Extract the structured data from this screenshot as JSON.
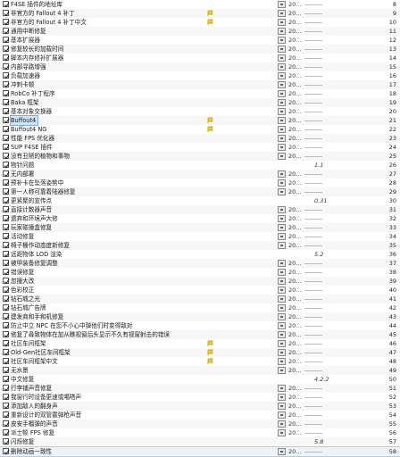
{
  "mod_list": {
    "rows": [
      {
        "name": "F4SE 插件的地址库",
        "cat": "20...",
        "pri": "8",
        "checked": true,
        "type": "mod",
        "flag": false,
        "box": true,
        "ver": ""
      },
      {
        "name": "非官方的 Fallout 4 补丁",
        "cat": "20...",
        "pri": "9",
        "checked": true,
        "type": "mod",
        "flag": true,
        "box": true,
        "ver": ""
      },
      {
        "name": "非官方的 Fallout 4 补丁中文",
        "cat": "20...",
        "pri": "10",
        "checked": true,
        "type": "mod",
        "flag": true,
        "box": true,
        "ver": ""
      },
      {
        "name": "通用中断修复",
        "cat": "20...",
        "pri": "11",
        "checked": true,
        "type": "mod",
        "flag": false,
        "box": true,
        "ver": ""
      },
      {
        "name": "基本扩展器",
        "cat": "20...",
        "pri": "12",
        "checked": true,
        "type": "mod",
        "flag": false,
        "box": true,
        "ver": ""
      },
      {
        "name": "修复较长的加载时间",
        "cat": "20...",
        "pri": "13",
        "checked": true,
        "type": "mod",
        "flag": false,
        "box": true,
        "ver": ""
      },
      {
        "name": "脚本内存修补扩展器",
        "cat": "20...",
        "pri": "14",
        "checked": true,
        "type": "mod",
        "flag": false,
        "box": true,
        "ver": ""
      },
      {
        "name": "内部寻路增强",
        "cat": "20...",
        "pri": "15",
        "checked": true,
        "type": "mod",
        "flag": false,
        "box": true,
        "ver": ""
      },
      {
        "name": "负载加速器",
        "cat": "20...",
        "pri": "16",
        "checked": true,
        "type": "mod",
        "flag": false,
        "box": true,
        "ver": ""
      },
      {
        "name": "冲刺卡顿",
        "cat": "20...",
        "pri": "17",
        "checked": true,
        "type": "mod",
        "flag": false,
        "box": true,
        "ver": ""
      },
      {
        "name": "RobCo 补丁程序",
        "cat": "20...",
        "pri": "18",
        "checked": true,
        "type": "mod",
        "flag": false,
        "box": true,
        "ver": ""
      },
      {
        "name": "Baka 框架",
        "cat": "20...",
        "pri": "19",
        "checked": true,
        "type": "mod",
        "flag": false,
        "box": true,
        "ver": ""
      },
      {
        "name": "基本对象交换器",
        "cat": "20...",
        "pri": "20",
        "checked": true,
        "type": "mod",
        "flag": false,
        "box": true,
        "ver": ""
      },
      {
        "name": "Buffout4",
        "cat": "20...",
        "pri": "21",
        "checked": true,
        "type": "mod",
        "flag": true,
        "box": true,
        "ver": "",
        "selected": true
      },
      {
        "name": "Buffout4 NG",
        "cat": "20...",
        "pri": "22",
        "checked": true,
        "type": "mod",
        "flag": true,
        "box": true,
        "ver": ""
      },
      {
        "name": "性能 FPS 优化器",
        "cat": "20...",
        "pri": "23",
        "checked": true,
        "type": "mod",
        "flag": false,
        "box": true,
        "ver": ""
      },
      {
        "name": "SUP F4SE 插件",
        "cat": "20...",
        "pri": "24",
        "checked": true,
        "type": "mod",
        "flag": false,
        "box": true,
        "ver": ""
      },
      {
        "name": "没有丑陋的植物和事物",
        "cat": "20...",
        "pri": "25",
        "checked": true,
        "type": "mod",
        "flag": false,
        "box": true,
        "ver": ""
      },
      {
        "name": "物针问题",
        "cat": "1.1",
        "pri": "26",
        "checked": true,
        "type": "mod",
        "flag": false,
        "box": false,
        "ver": "",
        "verstyle": true
      },
      {
        "name": "无内部署",
        "cat": "20...",
        "pri": "27",
        "checked": true,
        "type": "mod",
        "flag": false,
        "box": true,
        "ver": ""
      },
      {
        "name": "预补卡在坠落姿势中",
        "cat": "20...",
        "pri": "28",
        "checked": true,
        "type": "mod",
        "flag": false,
        "box": true,
        "ver": ""
      },
      {
        "name": "第一人称可靠着陆器修复",
        "cat": "20...",
        "pri": "29",
        "checked": true,
        "type": "mod",
        "flag": false,
        "box": true,
        "ver": ""
      },
      {
        "name": "更紧聚的宣传点",
        "cat": "0.31",
        "pri": "30",
        "checked": true,
        "type": "mod",
        "flag": false,
        "box": false,
        "ver": "",
        "verstyle": true
      },
      {
        "name": "直接计数器声音",
        "cat": "20...",
        "pri": "31",
        "checked": true,
        "type": "mod",
        "flag": false,
        "box": true,
        "ver": ""
      },
      {
        "name": "遗弃和环境声大修",
        "cat": "20...",
        "pri": "32",
        "checked": true,
        "type": "mod",
        "flag": false,
        "box": true,
        "ver": ""
      },
      {
        "name": "玩家碰撞盒修复",
        "cat": "20...",
        "pri": "33",
        "checked": true,
        "type": "mod",
        "flag": false,
        "box": true,
        "ver": ""
      },
      {
        "name": "活动修复",
        "cat": "20...",
        "pri": "34",
        "checked": true,
        "type": "mod",
        "flag": false,
        "box": true,
        "ver": ""
      },
      {
        "name": "椅子栅作动态度新修复",
        "cat": "20...",
        "pri": "35",
        "checked": true,
        "type": "mod",
        "flag": false,
        "box": true,
        "ver": ""
      },
      {
        "name": "远距物体 LOD 渲染",
        "cat": "5.2",
        "pri": "36",
        "checked": true,
        "type": "mod",
        "flag": false,
        "box": false,
        "ver": "",
        "verstyle": true
      },
      {
        "name": "被甲装备修复调整",
        "cat": "20...",
        "pri": "37",
        "checked": true,
        "type": "mod",
        "flag": false,
        "box": true,
        "ver": ""
      },
      {
        "name": "错误修复",
        "cat": "20...",
        "pri": "38",
        "checked": true,
        "type": "mod",
        "flag": false,
        "box": true,
        "ver": ""
      },
      {
        "name": "忽撞大改",
        "cat": "20...",
        "pri": "39",
        "checked": true,
        "type": "mod",
        "flag": false,
        "box": true,
        "ver": ""
      },
      {
        "name": "色彩校正",
        "cat": "20...",
        "pri": "40",
        "checked": true,
        "type": "mod",
        "flag": false,
        "box": true,
        "ver": ""
      },
      {
        "name": "钻石城之光",
        "cat": "20...",
        "pri": "41",
        "checked": true,
        "type": "mod",
        "flag": false,
        "box": true,
        "ver": ""
      },
      {
        "name": "钻石城广告牌",
        "cat": "20...",
        "pri": "42",
        "checked": true,
        "type": "mod",
        "flag": false,
        "box": true,
        "ver": ""
      },
      {
        "name": "建发商和手和机修复",
        "cat": "20...",
        "pri": "43",
        "checked": true,
        "type": "mod",
        "flag": false,
        "box": true,
        "ver": ""
      },
      {
        "name": "防止中立 NPC 在您不小心中弹他们时变得敌对",
        "cat": "20...",
        "pri": "44",
        "checked": true,
        "type": "mod",
        "flag": false,
        "box": true,
        "ver": ""
      },
      {
        "name": "修复了尋致物体在加从瞧视窗后头显示不久有视窗射击的错误",
        "cat": "20...",
        "pri": "45",
        "checked": true,
        "type": "mod",
        "flag": false,
        "box": true,
        "ver": ""
      },
      {
        "name": "社区车间框架",
        "cat": "20...",
        "pri": "46",
        "checked": true,
        "type": "mod",
        "flag": true,
        "box": true,
        "ver": ""
      },
      {
        "name": "Old-Gen社区车间框架",
        "cat": "20...",
        "pri": "47",
        "checked": true,
        "type": "mod",
        "flag": true,
        "box": true,
        "ver": ""
      },
      {
        "name": "社区车间框架中文",
        "cat": "20...",
        "pri": "48",
        "checked": true,
        "type": "mod",
        "flag": true,
        "box": true,
        "ver": ""
      },
      {
        "name": "无水景",
        "cat": "20...",
        "pri": "49",
        "checked": true,
        "type": "mod",
        "flag": false,
        "box": true,
        "ver": ""
      },
      {
        "name": "中文修复",
        "cat": "4.2.2",
        "pri": "50",
        "checked": true,
        "type": "mod",
        "flag": false,
        "box": false,
        "ver": "",
        "verstyle": true
      },
      {
        "name": "行李铺声音修复",
        "cat": "20...",
        "pri": "51",
        "checked": true,
        "type": "mod",
        "flag": false,
        "box": true,
        "ver": ""
      },
      {
        "name": "我窗行时设备更速或噶嗒声",
        "cat": "20...",
        "pri": "52",
        "checked": true,
        "type": "mod",
        "flag": false,
        "box": true,
        "ver": ""
      },
      {
        "name": "添加敌人的翻身声",
        "cat": "20...",
        "pri": "53",
        "checked": true,
        "type": "mod",
        "flag": false,
        "box": true,
        "ver": ""
      },
      {
        "name": "重新设计的双管霰弹枪声音",
        "cat": "20...",
        "pri": "54",
        "checked": true,
        "type": "mod",
        "flag": false,
        "box": true,
        "ver": ""
      },
      {
        "name": "皮安手榴弹的声音",
        "cat": "20...",
        "pri": "55",
        "checked": true,
        "type": "mod",
        "flag": false,
        "box": true,
        "ver": ""
      },
      {
        "name": "派士顿 FPS 修复",
        "cat": "20...",
        "pri": "56",
        "checked": true,
        "type": "mod",
        "flag": false,
        "box": true,
        "ver": ""
      },
      {
        "name": "闪烁修复",
        "cat": "5.8",
        "pri": "57",
        "checked": true,
        "type": "mod",
        "flag": false,
        "box": false,
        "ver": "",
        "verstyle": true
      },
      {
        "name": "删除动画一致性",
        "cat": "20...",
        "pri": "58",
        "checked": true,
        "type": "mod",
        "flag": false,
        "box": true,
        "ver": "",
        "last": true
      }
    ]
  },
  "colors": {
    "selected_bg": "#cfe3f7",
    "flag_yellow": "#e0b800"
  }
}
